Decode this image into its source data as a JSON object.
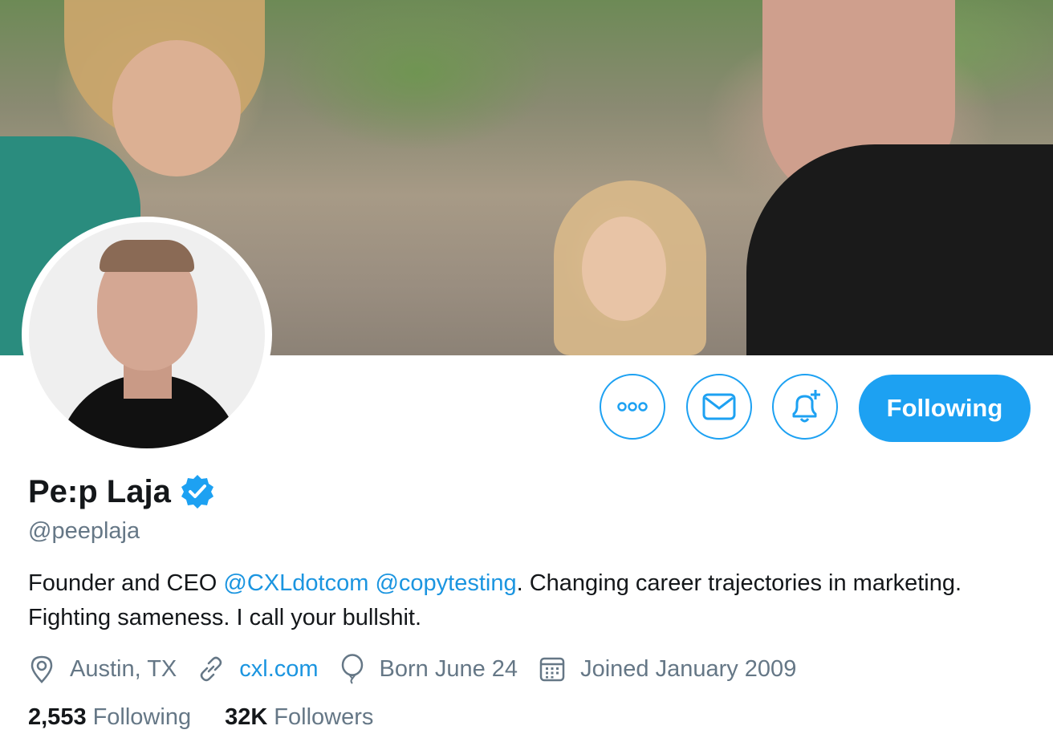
{
  "profile": {
    "name": "Pe:p Laja",
    "handle": "@peeplaja",
    "bio": {
      "prefix": "Founder and CEO ",
      "mention1": "@CXLdotcom",
      "space": " ",
      "mention2": "@copytesting",
      "suffix": ". Changing career trajectories in marketing. Fighting sameness. I call your bullshit."
    },
    "location": "Austin, TX",
    "website": "cxl.com",
    "birthday": "Born June 24",
    "joined": "Joined January 2009"
  },
  "stats": {
    "following_count": "2,553",
    "following_label": "Following",
    "followers_count": "32K",
    "followers_label": "Followers"
  },
  "actions": {
    "follow_button": "Following"
  },
  "icons": {
    "more": "more-icon",
    "message": "envelope-icon",
    "notify": "bell-plus-icon",
    "verified": "verified-badge-icon",
    "location": "location-pin-icon",
    "link": "link-icon",
    "birthday": "balloon-icon",
    "calendar": "calendar-icon"
  },
  "colors": {
    "accent": "#1da1f2",
    "link": "#1b95e0",
    "text": "#14171a",
    "secondary": "#657786"
  }
}
